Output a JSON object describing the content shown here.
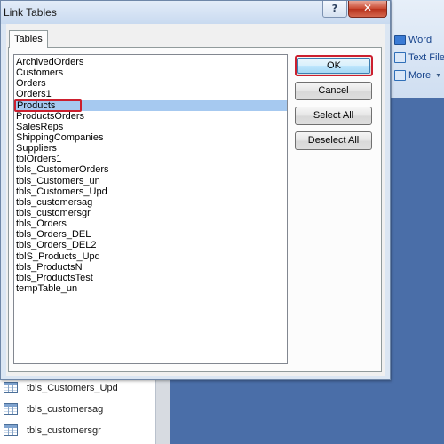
{
  "dialog": {
    "title": "Link Tables",
    "help_glyph": "?",
    "close_glyph": "✕",
    "tab_label": "Tables",
    "tables": [
      "ArchivedOrders",
      "Customers",
      "Orders",
      "Orders1",
      "Products",
      "ProductsOrders",
      "SalesReps",
      "ShippingCompanies",
      "Suppliers",
      "tblOrders1",
      "tbls_CustomerOrders",
      "tbls_Customers_un",
      "tbls_Customers_Upd",
      "tbls_customersag",
      "tbls_customersgr",
      "tbls_Orders",
      "tbls_Orders_DEL",
      "tbls_Orders_DEL2",
      "tblS_Products_Upd",
      "tbls_ProductsN",
      "tbls_ProductsTest",
      "tempTable_un"
    ],
    "selected_table": "Products",
    "buttons": {
      "ok": "OK",
      "cancel": "Cancel",
      "select_all": "Select All",
      "deselect_all": "Deselect All"
    }
  },
  "ribbon": {
    "word": "Word",
    "text_file": "Text File",
    "more": "More"
  },
  "nav_pane": {
    "items": [
      "tbls_Customers_Upd",
      "tbls_customersag",
      "tbls_customersgr"
    ]
  },
  "colors": {
    "highlight_red": "#cc1f2e",
    "selection_blue": "#a6c9f0",
    "background_blue": "#4a6ea8"
  }
}
